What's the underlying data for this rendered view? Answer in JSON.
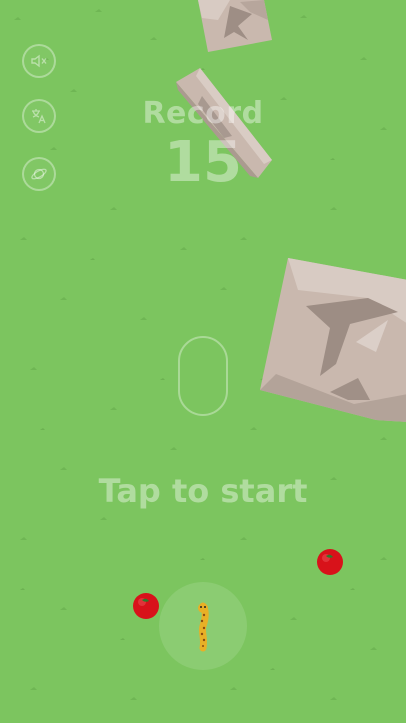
{
  "game": {
    "record_label": "Record",
    "record_value": "15",
    "prompt": "Tap to start"
  },
  "buttons": {
    "sound": {
      "icon": "speaker-muted-icon"
    },
    "language": {
      "icon": "translate-icon"
    },
    "world": {
      "icon": "planet-icon"
    }
  },
  "colors": {
    "grass": "#7cc55f",
    "apple": "#d8121a",
    "rock": "#c9b8ae",
    "snake": "#e8b026"
  }
}
